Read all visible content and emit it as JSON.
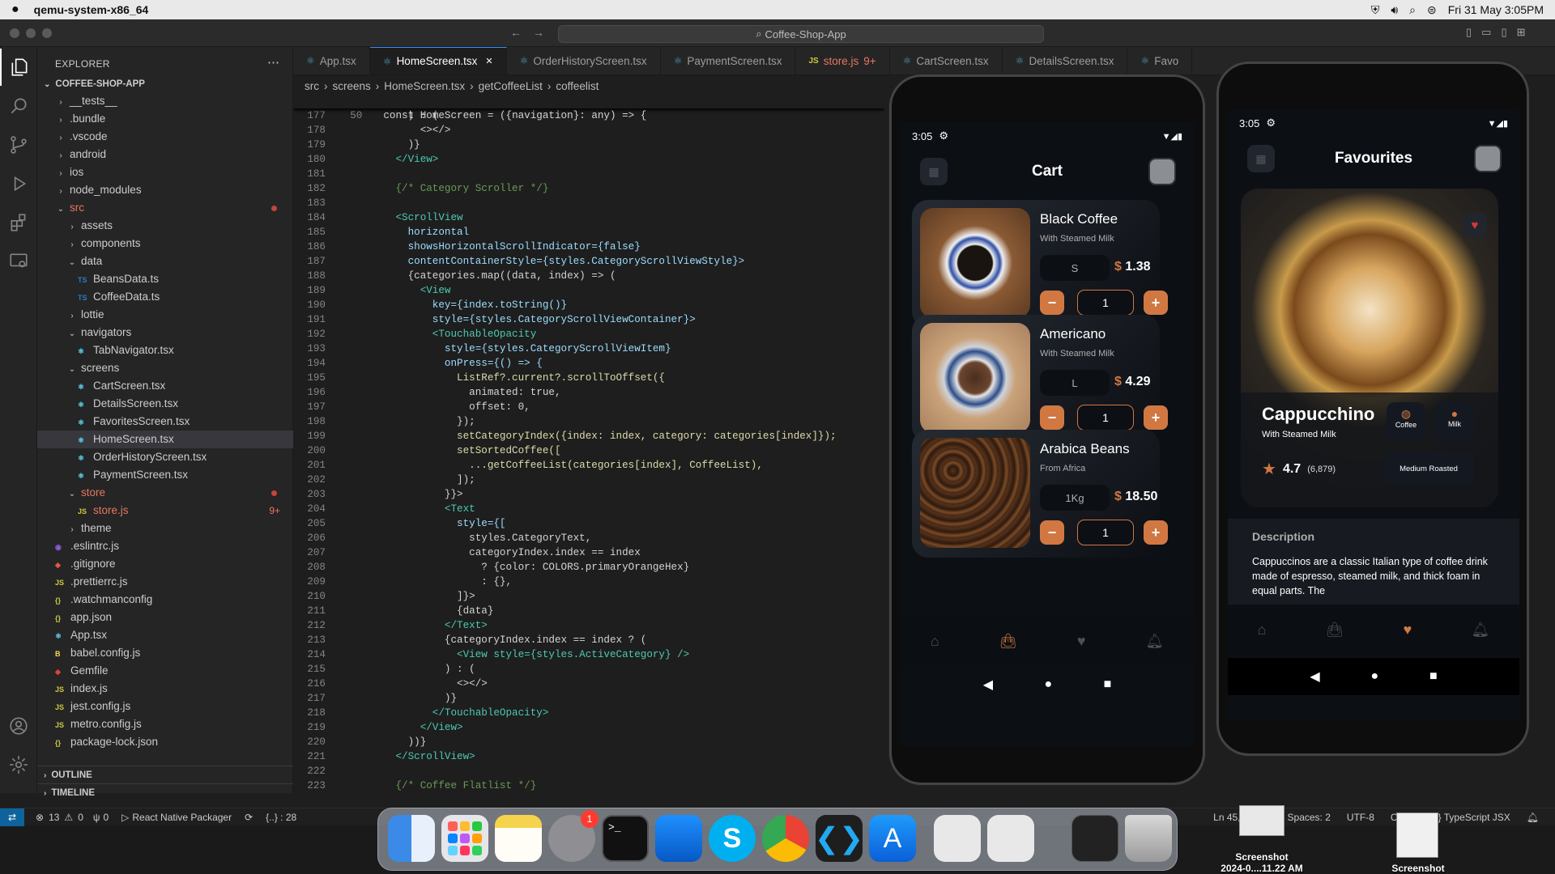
{
  "menubar": {
    "app_name": "qemu-system-x86_64",
    "datetime": "Fri 31 May  3:05PM"
  },
  "titlebar": {
    "command_center": "Coffee-Shop-App"
  },
  "explorer": {
    "title": "EXPLORER",
    "root": "COFFEE-SHOP-APP",
    "items": [
      {
        "label": "__tests__",
        "depth": 1,
        "type": "folder"
      },
      {
        "label": ".bundle",
        "depth": 1,
        "type": "folder"
      },
      {
        "label": ".vscode",
        "depth": 1,
        "type": "folder"
      },
      {
        "label": "android",
        "depth": 1,
        "type": "folder"
      },
      {
        "label": "ios",
        "depth": 1,
        "type": "folder"
      },
      {
        "label": "node_modules",
        "depth": 1,
        "type": "folder"
      },
      {
        "label": "src",
        "depth": 1,
        "type": "folder-open",
        "status": "dot"
      },
      {
        "label": "assets",
        "depth": 2,
        "type": "folder"
      },
      {
        "label": "components",
        "depth": 2,
        "type": "folder"
      },
      {
        "label": "data",
        "depth": 2,
        "type": "folder-open"
      },
      {
        "label": "BeansData.ts",
        "depth": 3,
        "type": "ts"
      },
      {
        "label": "CoffeeData.ts",
        "depth": 3,
        "type": "ts"
      },
      {
        "label": "lottie",
        "depth": 2,
        "type": "folder"
      },
      {
        "label": "navigators",
        "depth": 2,
        "type": "folder-open"
      },
      {
        "label": "TabNavigator.tsx",
        "depth": 3,
        "type": "tsx"
      },
      {
        "label": "screens",
        "depth": 2,
        "type": "folder-open"
      },
      {
        "label": "CartScreen.tsx",
        "depth": 3,
        "type": "tsx"
      },
      {
        "label": "DetailsScreen.tsx",
        "depth": 3,
        "type": "tsx"
      },
      {
        "label": "FavoritesScreen.tsx",
        "depth": 3,
        "type": "tsx"
      },
      {
        "label": "HomeScreen.tsx",
        "depth": 3,
        "type": "tsx",
        "selected": true
      },
      {
        "label": "OrderHistoryScreen.tsx",
        "depth": 3,
        "type": "tsx"
      },
      {
        "label": "PaymentScreen.tsx",
        "depth": 3,
        "type": "tsx"
      },
      {
        "label": "store",
        "depth": 2,
        "type": "folder-open",
        "status": "dot"
      },
      {
        "label": "store.js",
        "depth": 3,
        "type": "js",
        "badge": "9+"
      },
      {
        "label": "theme",
        "depth": 2,
        "type": "folder"
      },
      {
        "label": ".eslintrc.js",
        "depth": 1,
        "type": "eslint"
      },
      {
        "label": ".gitignore",
        "depth": 1,
        "type": "git"
      },
      {
        "label": ".prettierrc.js",
        "depth": 1,
        "type": "js"
      },
      {
        "label": ".watchmanconfig",
        "depth": 1,
        "type": "json"
      },
      {
        "label": "app.json",
        "depth": 1,
        "type": "json"
      },
      {
        "label": "App.tsx",
        "depth": 1,
        "type": "tsx"
      },
      {
        "label": "babel.config.js",
        "depth": 1,
        "type": "babel"
      },
      {
        "label": "Gemfile",
        "depth": 1,
        "type": "gem"
      },
      {
        "label": "index.js",
        "depth": 1,
        "type": "js"
      },
      {
        "label": "jest.config.js",
        "depth": 1,
        "type": "js"
      },
      {
        "label": "metro.config.js",
        "depth": 1,
        "type": "js"
      },
      {
        "label": "package-lock.json",
        "depth": 1,
        "type": "json"
      }
    ],
    "outline": "OUTLINE",
    "timeline": "TIMELINE"
  },
  "tabs": [
    {
      "label": "App.tsx",
      "type": "tsx"
    },
    {
      "label": "HomeScreen.tsx",
      "type": "tsx",
      "active": true
    },
    {
      "label": "OrderHistoryScreen.tsx",
      "type": "tsx"
    },
    {
      "label": "PaymentScreen.tsx",
      "type": "tsx"
    },
    {
      "label": "store.js",
      "type": "js",
      "badge": "9+"
    },
    {
      "label": "CartScreen.tsx",
      "type": "tsx"
    },
    {
      "label": "DetailsScreen.tsx",
      "type": "tsx"
    },
    {
      "label": "Favo",
      "type": "tsx"
    }
  ],
  "breadcrumb": [
    "src",
    "screens",
    "HomeScreen.tsx",
    "getCoffeeList",
    "coffeelist"
  ],
  "sticky_line": {
    "num": "50",
    "text": "const HomeScreen = ({navigation}: any) => {"
  },
  "code_lines": [
    {
      "num": "177",
      "text": "          ) : ("
    },
    {
      "num": "178",
      "text": "            <></>"
    },
    {
      "num": "179",
      "text": "          )}"
    },
    {
      "num": "180",
      "text": "        </View>"
    },
    {
      "num": "181",
      "text": ""
    },
    {
      "num": "182",
      "text": "        {/* Category Scroller */}"
    },
    {
      "num": "183",
      "text": ""
    },
    {
      "num": "184",
      "text": "        <ScrollView"
    },
    {
      "num": "185",
      "text": "          horizontal"
    },
    {
      "num": "186",
      "text": "          showsHorizontalScrollIndicator={false}"
    },
    {
      "num": "187",
      "text": "          contentContainerStyle={styles.CategoryScrollViewStyle}>"
    },
    {
      "num": "188",
      "text": "          {categories.map((data, index) => ("
    },
    {
      "num": "189",
      "text": "            <View"
    },
    {
      "num": "190",
      "text": "              key={index.toString()}"
    },
    {
      "num": "191",
      "text": "              style={styles.CategoryScrollViewContainer}>"
    },
    {
      "num": "192",
      "text": "              <TouchableOpacity"
    },
    {
      "num": "193",
      "text": "                style={styles.CategoryScrollViewItem}"
    },
    {
      "num": "194",
      "text": "                onPress={() => {"
    },
    {
      "num": "195",
      "text": "                  ListRef?.current?.scrollToOffset({"
    },
    {
      "num": "196",
      "text": "                    animated: true,"
    },
    {
      "num": "197",
      "text": "                    offset: 0,"
    },
    {
      "num": "198",
      "text": "                  });"
    },
    {
      "num": "199",
      "text": "                  setCategoryIndex({index: index, category: categories[index]});"
    },
    {
      "num": "200",
      "text": "                  setSortedCoffee(["
    },
    {
      "num": "201",
      "text": "                    ...getCoffeeList(categories[index], CoffeeList),"
    },
    {
      "num": "202",
      "text": "                  ]);"
    },
    {
      "num": "203",
      "text": "                }}>"
    },
    {
      "num": "204",
      "text": "                <Text"
    },
    {
      "num": "205",
      "text": "                  style={["
    },
    {
      "num": "206",
      "text": "                    styles.CategoryText,"
    },
    {
      "num": "207",
      "text": "                    categoryIndex.index == index"
    },
    {
      "num": "208",
      "text": "                      ? {color: COLORS.primaryOrangeHex}"
    },
    {
      "num": "209",
      "text": "                      : {},"
    },
    {
      "num": "210",
      "text": "                  ]}>"
    },
    {
      "num": "211",
      "text": "                  {data}"
    },
    {
      "num": "212",
      "text": "                </Text>"
    },
    {
      "num": "213",
      "text": "                {categoryIndex.index == index ? ("
    },
    {
      "num": "214",
      "text": "                  <View style={styles.ActiveCategory} />"
    },
    {
      "num": "215",
      "text": "                ) : ("
    },
    {
      "num": "216",
      "text": "                  <></>"
    },
    {
      "num": "217",
      "text": "                )}"
    },
    {
      "num": "218",
      "text": "              </TouchableOpacity>"
    },
    {
      "num": "219",
      "text": "            </View>"
    },
    {
      "num": "220",
      "text": "          ))}"
    },
    {
      "num": "221",
      "text": "        </ScrollView>"
    },
    {
      "num": "222",
      "text": ""
    },
    {
      "num": "223",
      "text": "        {/* Coffee Flatlist */}"
    }
  ],
  "cart_phone": {
    "time": "3:05",
    "title": "Cart",
    "items": [
      {
        "name": "Black Coffee",
        "subtitle": "With Steamed Milk",
        "size": "S",
        "currency": "$",
        "price": "1.38",
        "qty": "1"
      },
      {
        "name": "Americano",
        "subtitle": "With Steamed Milk",
        "size": "L",
        "currency": "$",
        "price": "4.29",
        "qty": "1"
      },
      {
        "name": "Arabica Beans",
        "subtitle": "From Africa",
        "size": "1Kg",
        "currency": "$",
        "price": "18.50",
        "qty": "1"
      }
    ]
  },
  "fav_phone": {
    "time": "3:05",
    "title": "Favourites",
    "product": {
      "name": "Cappucchino",
      "subtitle": "With Steamed Milk",
      "tag1": "Coffee",
      "tag2": "Milk",
      "rating": "4.7",
      "rating_count": "(6,879)",
      "roast": "Medium Roasted",
      "desc_title": "Description",
      "desc_text": "Cappuccinos are a classic Italian type of coffee drink made of espresso, steamed milk, and thick foam in equal parts. The"
    }
  },
  "statusbar": {
    "errors": "13",
    "warnings": "0",
    "ports": "0",
    "packager": "React Native Packager",
    "braces": "{..} : 28",
    "position": "Ln 45, Col 33",
    "spaces": "Spaces: 2",
    "encoding": "UTF-8",
    "eol": "CRLF",
    "language": "TypeScript JSX"
  },
  "dock": {
    "badge_count": "1"
  },
  "desktop": {
    "shot1_label": "Screenshot",
    "shot1_sub": "2024-0....11.22 AM",
    "shot2_label": "Screenshot"
  }
}
